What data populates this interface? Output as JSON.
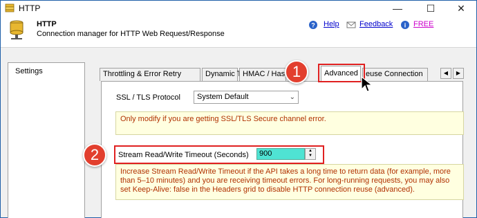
{
  "window": {
    "title": "HTTP"
  },
  "header": {
    "title": "HTTP",
    "subtitle": "Connection manager for HTTP Web Request/Response",
    "links": {
      "help": "Help",
      "feedback": "Feedback",
      "free": "FREE"
    }
  },
  "left_panel": {
    "items": [
      {
        "label": "Settings"
      }
    ]
  },
  "tabs": [
    {
      "label": "Throttling & Error Retry"
    },
    {
      "label": "Dynamic Token"
    },
    {
      "label": "HMAC / Hash"
    },
    {
      "label": "Advanced"
    },
    {
      "label": "euse Connection"
    }
  ],
  "advanced": {
    "ssl_label": "SSL / TLS Protocol",
    "ssl_value": "System Default",
    "ssl_note": "Only modify if you are getting SSL/TLS Secure channel error.",
    "timeout_label": "Stream Read/Write Timeout (Seconds)",
    "timeout_value": "900",
    "timeout_note": "Increase Stream Read/Write Timeout if the API takes a long time to return data (for example, more than 5–10 minutes) and you are receiving timeout errors. For long-running requests, you may also set Keep-Alive: false in the Headers grid to disable HTTP connection reuse (advanced)."
  },
  "callouts": {
    "step1": "1",
    "step2": "2"
  },
  "colors": {
    "accent_red": "#e23f2e",
    "note_bg": "#ffffe0",
    "note_text": "#b03000",
    "input_highlight": "#4fe3d3"
  }
}
